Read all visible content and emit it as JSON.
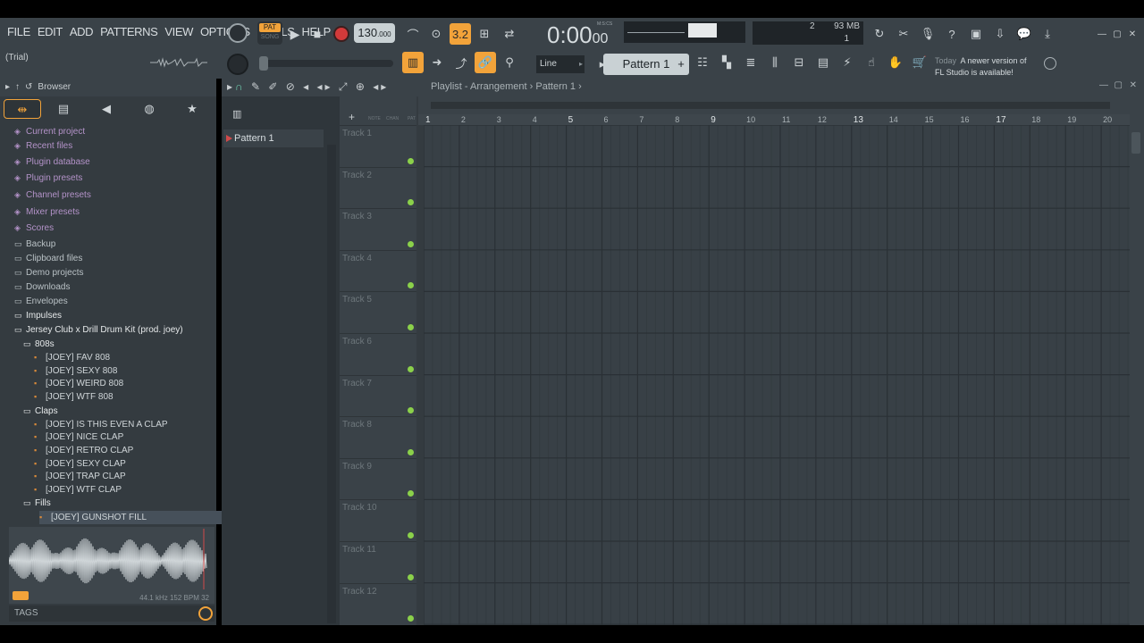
{
  "menu": [
    "FILE",
    "EDIT",
    "ADD",
    "PATTERNS",
    "VIEW",
    "OPTIONS",
    "TOOLS",
    "HELP"
  ],
  "trial_label": "(Trial)",
  "transport": {
    "pat_label": "PAT",
    "song_label": "SONG",
    "tempo": "130",
    "tempo_decimal": ".000"
  },
  "time_display": {
    "main": "0:00",
    "sub": "00",
    "unit_label": "M:S:CS"
  },
  "cpu_monitor": {
    "voices": "2",
    "memory": "93 MB",
    "polyphony": "1"
  },
  "snap_mode": "Line",
  "pattern_selector": "Pattern 1",
  "news": {
    "day": "Today",
    "message_line1": "A newer version of",
    "message_line2": "FL Studio is available!"
  },
  "browser": {
    "title": "Browser",
    "items": [
      {
        "label": "Current project",
        "type": "purple"
      },
      {
        "label": "Recent files",
        "type": "purple"
      },
      {
        "label": "Plugin database",
        "type": "purple"
      },
      {
        "label": "Plugin presets",
        "type": "purple"
      },
      {
        "label": "Channel presets",
        "type": "purple"
      },
      {
        "label": "Mixer presets",
        "type": "purple"
      },
      {
        "label": "Scores",
        "type": "purple"
      },
      {
        "label": "Backup",
        "type": "folder"
      },
      {
        "label": "Clipboard files",
        "type": "folder"
      },
      {
        "label": "Demo projects",
        "type": "folder"
      },
      {
        "label": "Downloads",
        "type": "folder"
      },
      {
        "label": "Envelopes",
        "type": "folder"
      },
      {
        "label": "Impulses",
        "type": "white"
      },
      {
        "label": "Jersey Club x Drill Drum Kit (prod. joey)",
        "type": "open-folder"
      },
      {
        "label": "808s",
        "type": "subfolder"
      },
      {
        "label": "[JOEY] FAV 808",
        "type": "sample"
      },
      {
        "label": "[JOEY] SEXY 808",
        "type": "sample"
      },
      {
        "label": "[JOEY] WEIRD 808",
        "type": "sample"
      },
      {
        "label": "[JOEY] WTF 808",
        "type": "sample"
      },
      {
        "label": "Claps",
        "type": "subfolder"
      },
      {
        "label": "[JOEY] IS THIS EVEN A CLAP",
        "type": "sample"
      },
      {
        "label": "[JOEY] NICE CLAP",
        "type": "sample"
      },
      {
        "label": "[JOEY] RETRO CLAP",
        "type": "sample"
      },
      {
        "label": "[JOEY] SEXY CLAP",
        "type": "sample"
      },
      {
        "label": "[JOEY] TRAP CLAP",
        "type": "sample"
      },
      {
        "label": "[JOEY] WTF CLAP",
        "type": "sample"
      },
      {
        "label": "Fills",
        "type": "subfolder"
      },
      {
        "label": "[JOEY] GUNSHOT FILL",
        "type": "sample-selected"
      }
    ],
    "sample_info": "44.1 kHz 152 BPM 32",
    "tags_label": "TAGS"
  },
  "playlist": {
    "title": "Playlist - Arrangement",
    "breadcrumb_pattern": "Pattern 1",
    "patterns": [
      "Pattern 1"
    ],
    "header_labels": [
      "NOTE",
      "CHAN",
      "PAT"
    ],
    "tracks": [
      "Track 1",
      "Track 2",
      "Track 3",
      "Track 4",
      "Track 5",
      "Track 6",
      "Track 7",
      "Track 8",
      "Track 9",
      "Track 10",
      "Track 11",
      "Track 12"
    ],
    "bars": [
      "1",
      "2",
      "3",
      "4",
      "5",
      "6",
      "7",
      "8",
      "9",
      "10",
      "11",
      "12",
      "13",
      "14",
      "15",
      "16",
      "17",
      "18",
      "19",
      "20"
    ]
  },
  "colors": {
    "accent": "#f2a33a",
    "record": "#d23a3a",
    "track_led": "#8bd14a",
    "grid_bg": "#384046"
  }
}
